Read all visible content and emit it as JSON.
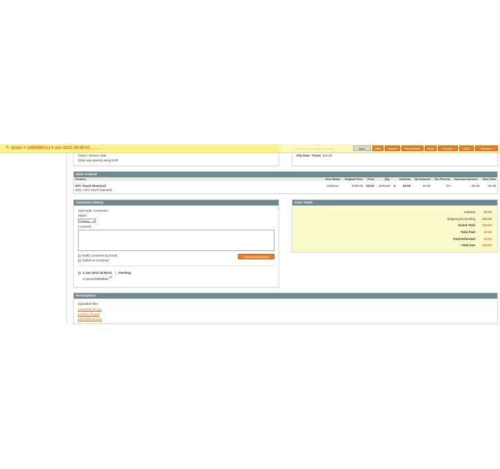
{
  "header": {
    "title": "Order # 100000013 | 4 Jun 2013 19:06:01",
    "faded_left": "Information",
    "faded_right": "Shipping & Handling Information",
    "buttons": [
      "Back",
      "Edit",
      "Cancel",
      "Send Email",
      "Hold",
      "Invoice",
      "Ship",
      "Reorder"
    ]
  },
  "payment": {
    "method": "Check / Money order",
    "currency_note": "Order was placed using EUR"
  },
  "shipping": {
    "method_label": "Flat Rate - Fixed",
    "method_price": "€10.00"
  },
  "items": {
    "heading": "Items Ordered",
    "columns": [
      "Product",
      "Item Status",
      "Original Price",
      "Price",
      "Qty",
      "Subtotal",
      "Tax Amount",
      "Tax Percent",
      "Discount Amount",
      "Row Total"
    ],
    "rows": [
      {
        "product": "HTC Touch Diamond",
        "sku": "SKU: HTC Touch Diamond",
        "status": "Ordered",
        "original_price": "€750.00",
        "price": "€0.00",
        "qty_label": "Ordered",
        "qty": "2",
        "subtotal": "€0.00",
        "tax_amount": "€0.00",
        "tax_percent": "0%",
        "discount": "€0.00",
        "row_total": "€0.00"
      }
    ]
  },
  "comments": {
    "heading": "Comments History",
    "add_label": "Add Order Comments",
    "status_label": "Status",
    "status_value": "Pending",
    "comment_label": "Comment",
    "notify_label": "Notify Customer by Email",
    "visible_label": "Visible on Frontend",
    "submit_label": "Submit Comment",
    "history": [
      {
        "date": "4 Jun 2013 19:06:01",
        "sep": "|",
        "status": "Pending",
        "customer_label": "Customer",
        "notified": "Notified"
      }
    ]
  },
  "totals": {
    "heading": "Order Totals",
    "rows": [
      {
        "label": "Subtotal",
        "value": "€0.00"
      },
      {
        "label": "Shipping & Handling",
        "value": "€10.00"
      },
      {
        "label": "Grand Total",
        "value": "€10.00"
      },
      {
        "label": "Total Paid",
        "value": "€0.00"
      },
      {
        "label": "Total Refunded",
        "value": "€0.00"
      },
      {
        "label": "Total Due",
        "value": "€10.00"
      }
    ]
  },
  "prescriptions": {
    "heading": "Prescriptions",
    "uploaded_label": "Uploaded files:",
    "files": [
      "uploaded_file.jpg",
      "another_file.pdf",
      "prescription1.png"
    ]
  },
  "colors": {
    "accent": "#eb5e00",
    "button": "#f07f24",
    "section_head": "#6f8992",
    "totals_bg": "#fbfaca",
    "header_bg": "#fbf28c"
  }
}
